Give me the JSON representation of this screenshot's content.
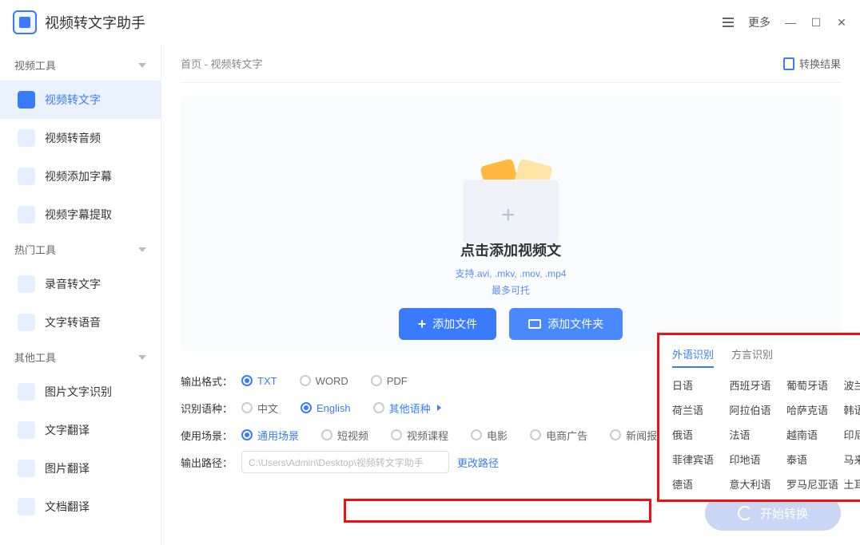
{
  "app_title": "视频转文字助手",
  "more_label": "更多",
  "sidebar": {
    "groups": [
      {
        "title": "视频工具",
        "items": [
          {
            "label": "视频转文字",
            "active": true
          },
          {
            "label": "视频转音频"
          },
          {
            "label": "视频添加字幕"
          },
          {
            "label": "视频字幕提取"
          }
        ]
      },
      {
        "title": "热门工具",
        "items": [
          {
            "label": "录音转文字"
          },
          {
            "label": "文字转语音"
          }
        ]
      },
      {
        "title": "其他工具",
        "items": [
          {
            "label": "图片文字识别"
          },
          {
            "label": "文字翻译"
          },
          {
            "label": "图片翻译"
          },
          {
            "label": "文档翻译"
          }
        ]
      }
    ]
  },
  "breadcrumb": "首页 - 视频转文字",
  "result_link": "转换结果",
  "drop": {
    "title_full": "点击添加视频文件",
    "title_visible": "点击添加视频文",
    "sub1": "支持.avi, .mkv, .mov, .mp4",
    "sub2_visible": "最多可托",
    "add_file": "添加文件",
    "add_folder": "添加文件夹"
  },
  "fmt": {
    "label": "输出格式：",
    "opts": [
      "TXT",
      "WORD",
      "PDF"
    ],
    "sel": 0
  },
  "lang": {
    "label": "识别语种：",
    "opts": [
      "中文",
      "English",
      "其他语种"
    ],
    "sel": 1
  },
  "scene": {
    "label": "使用场景：",
    "opts": [
      "通用场景",
      "短视频",
      "视频课程",
      "电影",
      "电商广告",
      "新闻报道"
    ],
    "sel": 0
  },
  "path": {
    "label": "输出路径：",
    "value": "C:\\Users\\Admin\\Desktop\\视频转文字助手",
    "change": "更改路径"
  },
  "start": "开始转换",
  "lang_pop": {
    "tabs": [
      "外语识别",
      "方言识别"
    ],
    "active": 0,
    "langs": [
      "日语",
      "西班牙语",
      "葡萄牙语",
      "波兰语",
      "荷兰语",
      "阿拉伯语",
      "哈萨克语",
      "韩语",
      "俄语",
      "法语",
      "越南语",
      "印尼语",
      "菲律宾语",
      "印地语",
      "泰语",
      "马来西亚语",
      "德语",
      "意大利语",
      "罗马尼亚语",
      "土耳其语"
    ]
  }
}
